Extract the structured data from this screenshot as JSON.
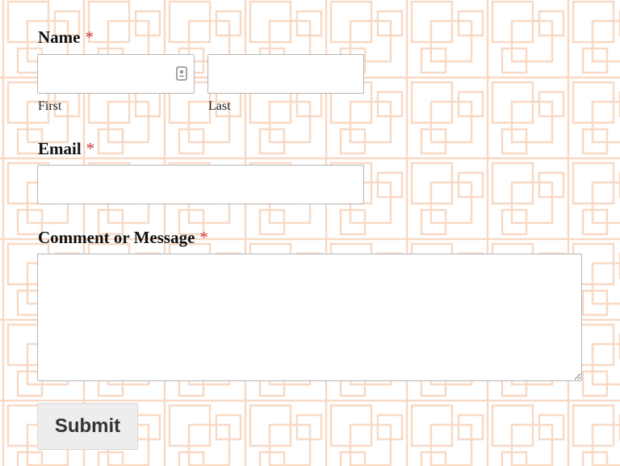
{
  "form": {
    "name": {
      "label": "Name",
      "required_mark": "*",
      "first_value": "",
      "first_sublabel": "First",
      "last_value": "",
      "last_sublabel": "Last"
    },
    "email": {
      "label": "Email",
      "required_mark": "*",
      "value": ""
    },
    "message": {
      "label": "Comment or Message",
      "required_mark": "*",
      "value": ""
    },
    "submit_label": "Submit"
  },
  "icons": {
    "first_name_field_icon": "contact-card-icon",
    "textarea_resize": "resize-handle-icon"
  },
  "colors": {
    "background": "#ffffff",
    "pattern_line": "#f8d9c4",
    "required": "#d63638",
    "input_border": "#b5b5b5",
    "button_bg": "#ededed",
    "button_text": "#333333"
  }
}
